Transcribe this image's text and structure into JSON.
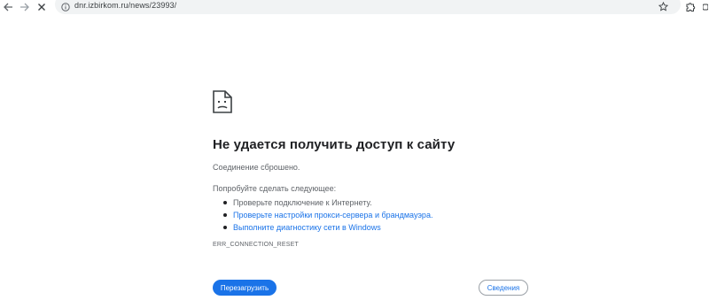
{
  "browser": {
    "url": "dnr.izbirkom.ru/news/23993/"
  },
  "error": {
    "title": "Не удается получить доступ к сайту",
    "message": "Соединение сброшено.",
    "suggestions_heading": "Попробуйте сделать следующее:",
    "suggestions": [
      {
        "text": "Проверьте подключение к Интернету.",
        "link": false
      },
      {
        "text": "Проверьте настройки прокси-сервера и брандмауэра.",
        "link": true
      },
      {
        "text": "Выполните диагностику сети в Windows",
        "link": true
      }
    ],
    "code": "ERR_CONNECTION_RESET",
    "reload_label": "Перезагрузить",
    "details_label": "Сведения"
  },
  "icons": {
    "back": "arrow-back-icon",
    "forward": "arrow-forward-icon",
    "stop": "close-icon",
    "site_info": "info-icon",
    "bookmark": "star-icon",
    "extensions": "puzzle-icon",
    "error": "sad-page-icon"
  },
  "colors": {
    "accent": "#1a73e8",
    "text": "#202124",
    "secondary_text": "#5f6368"
  }
}
